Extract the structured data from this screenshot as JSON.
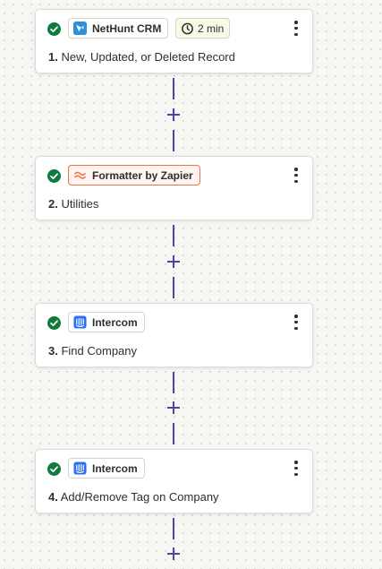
{
  "steps": [
    {
      "number": "1.",
      "title": "New, Updated, or Deleted Record",
      "app": "NetHunt CRM",
      "app_icon": "nethunt-crm-logo-icon",
      "status": "complete",
      "delay": "2 min"
    },
    {
      "number": "2.",
      "title": "Utilities",
      "app": "Formatter by Zapier",
      "app_icon": "formatter-logo-icon",
      "status": "complete"
    },
    {
      "number": "3.",
      "title": "Find Company",
      "app": "Intercom",
      "app_icon": "intercom-logo-icon",
      "status": "complete"
    },
    {
      "number": "4.",
      "title": "Add/Remove Tag on Company",
      "app": "Intercom",
      "app_icon": "intercom-logo-icon",
      "status": "complete"
    }
  ],
  "colors": {
    "connector": "#4f44a1",
    "success": "#0f7a3c",
    "formatter_accent": "#e8744a",
    "intercom_blue": "#286efa",
    "nethunt_blue": "#2f8fd8",
    "delay_badge_bg": "#f6fbe6"
  },
  "icons": {
    "status": "check-circle-icon",
    "delay": "stopwatch-icon",
    "menu": "more-vertical-icon",
    "add": "plus-icon"
  }
}
